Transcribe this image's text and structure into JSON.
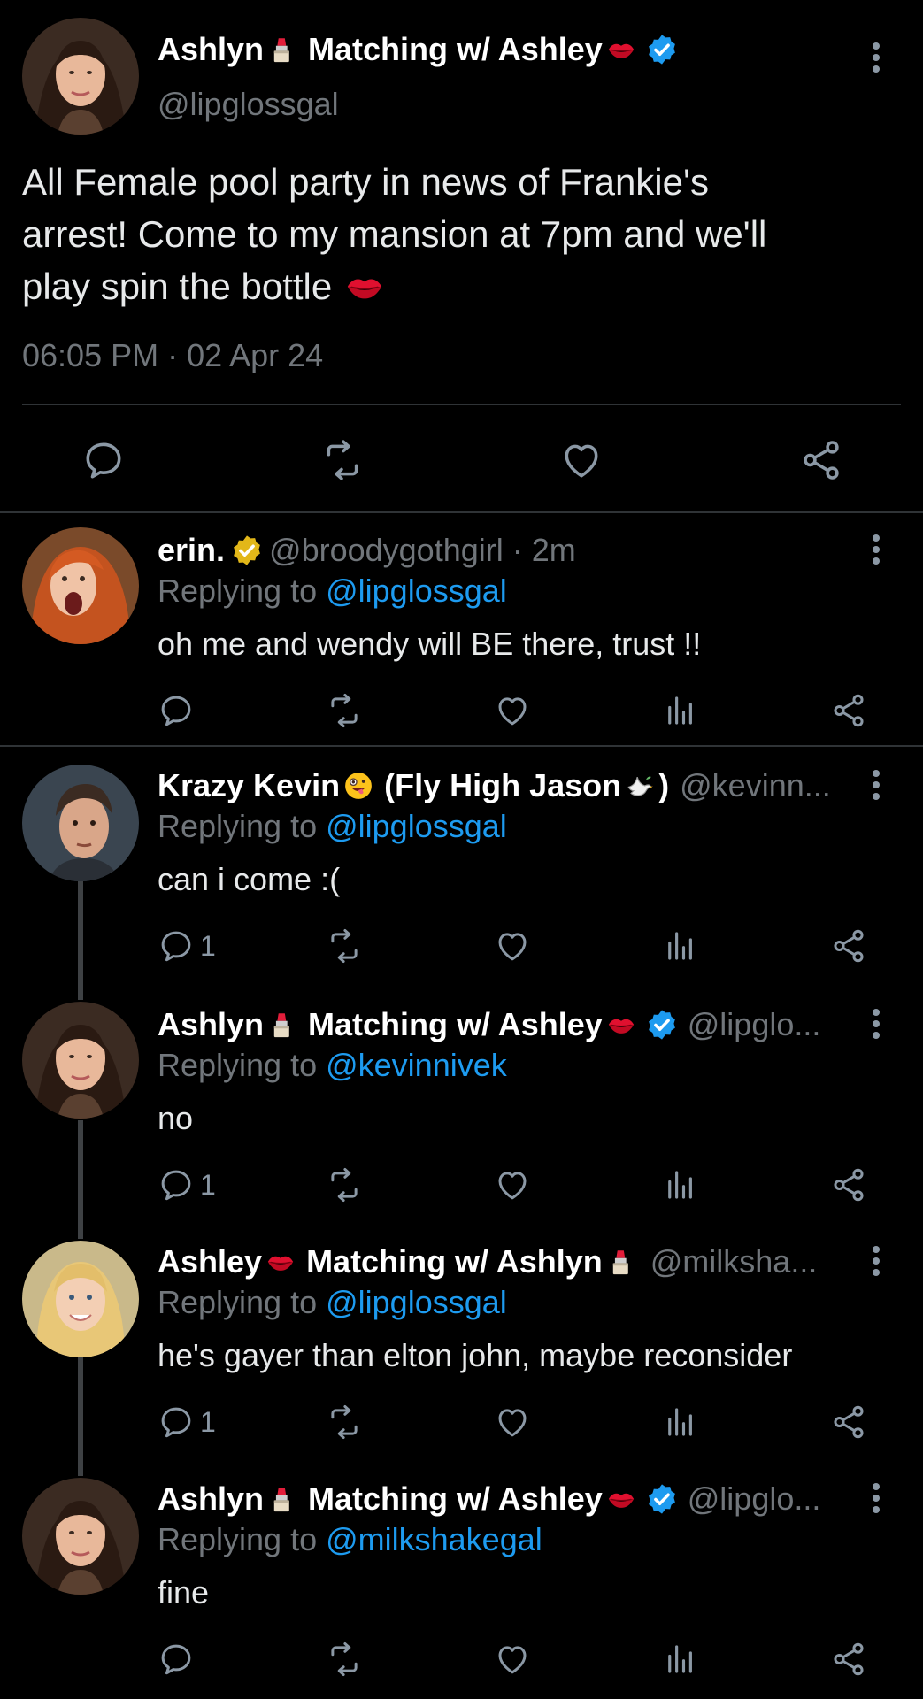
{
  "main_tweet": {
    "display_name": "Ashlyn",
    "name_suffix": "Matching w/ Ashley",
    "handle": "@lipglossgal",
    "text_lines": [
      "All Female pool party in news of Frankie's",
      "arrest! Come to my mansion at 7pm and we'll",
      "play spin the bottle"
    ],
    "timestamp": "06:05 PM · 02 Apr 24"
  },
  "replies": [
    {
      "display_name": "erin.",
      "handle_meta": "@broodygothgirl · 2m",
      "replying_prefix": "Replying to ",
      "replying_to": "@lipglossgal",
      "text": "oh me and wendy will BE there, trust !!",
      "reply_count": ""
    },
    {
      "display_name": "Krazy Kevin",
      "name_suffix": "(Fly High Jason",
      "name_close": ")",
      "handle_meta": "@kevinn...",
      "replying_prefix": "Replying to ",
      "replying_to": "@lipglossgal",
      "text": "can i come :(",
      "reply_count": "1"
    },
    {
      "display_name": "Ashlyn",
      "name_suffix": "Matching w/ Ashley",
      "handle_meta": "@lipglo...",
      "replying_prefix": "Replying to ",
      "replying_to": "@kevinnivek",
      "text": "no",
      "reply_count": "1"
    },
    {
      "display_name": "Ashley",
      "name_suffix": "Matching w/ Ashlyn",
      "handle_meta": "@milksha...",
      "replying_prefix": "Replying to ",
      "replying_to": "@lipglossgal",
      "text": "he's gayer than elton john, maybe reconsider",
      "reply_count": "1"
    },
    {
      "display_name": "Ashlyn",
      "name_suffix": "Matching w/ Ashley",
      "handle_meta": "@lipglo...",
      "replying_prefix": "Replying to ",
      "replying_to": "@milkshakegal",
      "text": "fine",
      "reply_count": ""
    }
  ],
  "icons": {
    "reply": "reply-icon",
    "retweet": "retweet-icon",
    "like": "like-icon",
    "views": "views-icon",
    "share": "share-icon",
    "more": "more-icon",
    "verified": "verified-badge-icon",
    "lipstick": "lipstick-emoji",
    "kiss": "kiss-emoji",
    "dove": "dove-emoji",
    "zany": "zany-face-emoji"
  },
  "colors": {
    "background": "#000000",
    "text": "#e7e9ea",
    "secondary": "#71767b",
    "accent": "#1d9bf0",
    "verified_blue": "#1d9bf0",
    "verified_gold": "#e2b719"
  }
}
